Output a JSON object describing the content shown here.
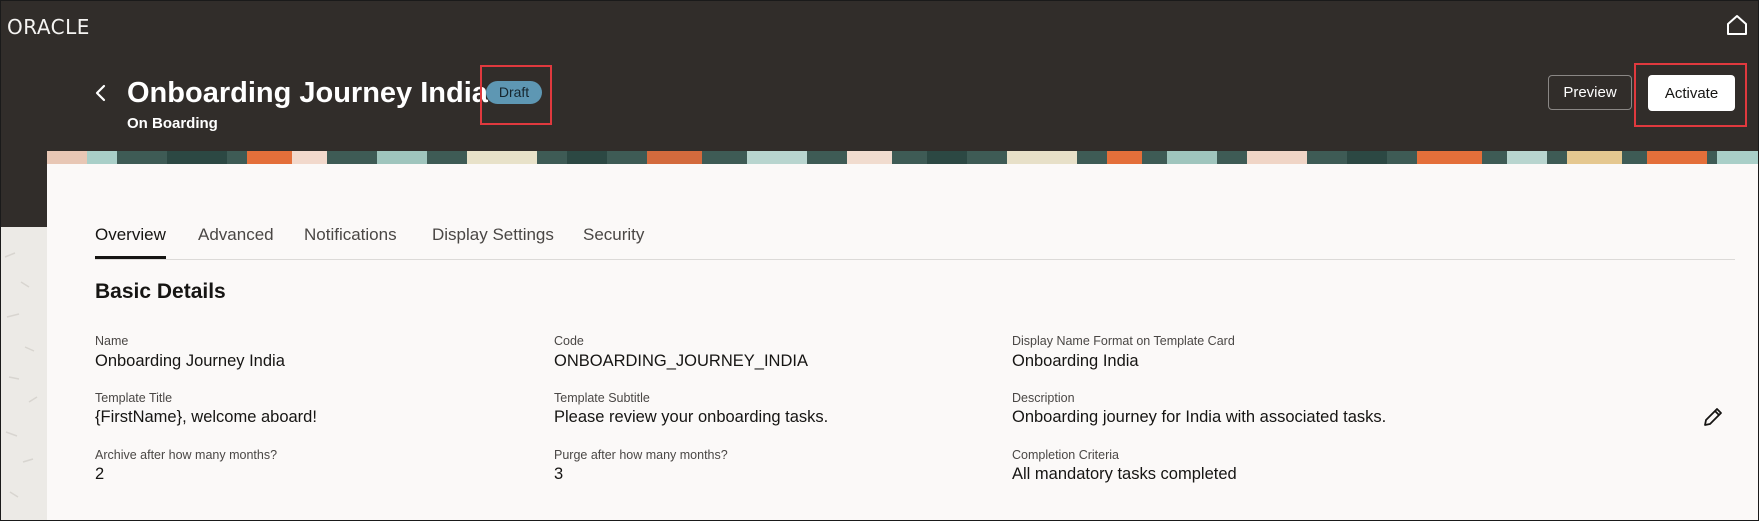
{
  "header": {
    "logo": "ORACLE",
    "title": "Onboarding Journey India",
    "subtitle": "On Boarding",
    "status_badge": "Draft",
    "preview_label": "Preview",
    "activate_label": "Activate"
  },
  "tabs": [
    {
      "label": "Overview",
      "active": true
    },
    {
      "label": "Advanced",
      "active": false
    },
    {
      "label": "Notifications",
      "active": false
    },
    {
      "label": "Display Settings",
      "active": false
    },
    {
      "label": "Security",
      "active": false
    }
  ],
  "section": {
    "title": "Basic Details",
    "fields": [
      {
        "label": "Name",
        "value": "Onboarding Journey India"
      },
      {
        "label": "Code",
        "value": "ONBOARDING_JOURNEY_INDIA"
      },
      {
        "label": "Display Name Format on Template Card",
        "value": "Onboarding India"
      },
      {
        "label": "Template Title",
        "value": "{FirstName}, welcome aboard!"
      },
      {
        "label": "Template Subtitle",
        "value": "Please review your onboarding tasks."
      },
      {
        "label": "Description",
        "value": "Onboarding journey for India with associated tasks."
      },
      {
        "label": "Archive after how many months?",
        "value": "2"
      },
      {
        "label": "Purge after how many months?",
        "value": "3"
      },
      {
        "label": "Completion Criteria",
        "value": "All mandatory tasks completed"
      }
    ]
  },
  "icons": {
    "home": "home-icon",
    "back": "chevron-left-icon",
    "edit": "pencil-icon"
  },
  "colors": {
    "header_bg": "#312d2a",
    "badge_bg": "#5e97b3",
    "highlight": "#e0393e",
    "card_bg": "#fbf9f8"
  }
}
